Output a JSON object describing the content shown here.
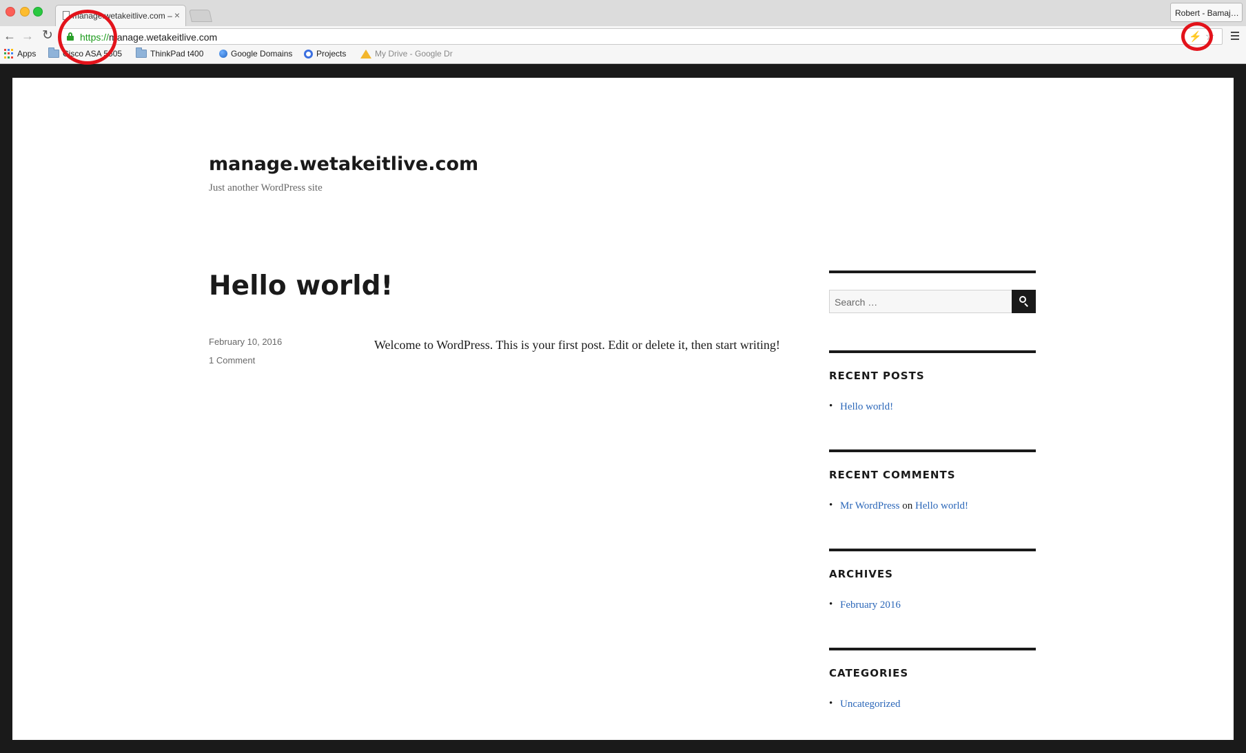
{
  "browser": {
    "tab_title": "manage.wetakeitlive.com – ",
    "profile_name": "Robert - Bamaj…",
    "url_scheme": "https://",
    "url_host": "manage.wetakeitlive.com",
    "bookmarks": [
      {
        "label": "Apps",
        "icon": "apps-icon"
      },
      {
        "label": "Cisco ASA 5505",
        "icon": "folder-icon"
      },
      {
        "label": "ThinkPad t400",
        "icon": "folder-icon"
      },
      {
        "label": "Google Domains",
        "icon": "globe-icon"
      },
      {
        "label": "Projects",
        "icon": "projects-icon"
      },
      {
        "label": "My Drive - Google Dr",
        "icon": "drive-icon"
      }
    ],
    "annotation_color": "#e3131b"
  },
  "site": {
    "title": "manage.wetakeitlive.com",
    "tagline": "Just another WordPress site"
  },
  "post": {
    "title": "Hello world!",
    "date": "February 10, 2016",
    "comments": "1 Comment",
    "content": "Welcome to WordPress. This is your first post. Edit or delete it, then start writing!"
  },
  "sidebar": {
    "search_placeholder": "Search …",
    "recent_posts": {
      "title": "RECENT POSTS",
      "items": [
        "Hello world!"
      ]
    },
    "recent_comments": {
      "title": "RECENT COMMENTS",
      "author": "Mr WordPress",
      "on": "on",
      "post": "Hello world!"
    },
    "archives": {
      "title": "ARCHIVES",
      "items": [
        "February 2016"
      ]
    },
    "categories": {
      "title": "CATEGORIES",
      "items": [
        "Uncategorized"
      ]
    }
  },
  "colors": {
    "link": "#2a66b8",
    "text": "#1a1a1a",
    "secure": "#1a9a1a"
  }
}
